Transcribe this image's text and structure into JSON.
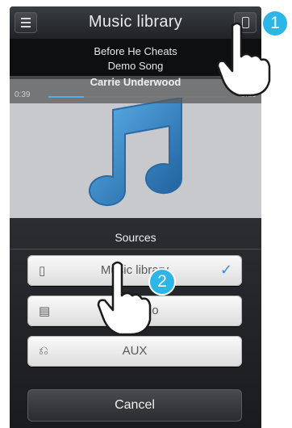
{
  "header": {
    "title": "Music library"
  },
  "now_playing": {
    "title": "Before He Cheats",
    "album": "Demo Song",
    "artist": "Carrie Underwood",
    "elapsed": "0:39",
    "total": "3:19",
    "progress": 0.2
  },
  "sources_sheet": {
    "title": "Sources",
    "items": [
      {
        "label": "Music library",
        "icon": "phone-icon",
        "selected": true
      },
      {
        "label": "FM radio",
        "icon": "radio-icon",
        "selected": false
      },
      {
        "label": "AUX",
        "icon": "aux-plug-icon",
        "selected": false
      }
    ],
    "cancel_label": "Cancel"
  },
  "callouts": [
    "1",
    "2"
  ],
  "colors": {
    "accent": "#2cb6e8",
    "check": "#3c8cdc"
  }
}
